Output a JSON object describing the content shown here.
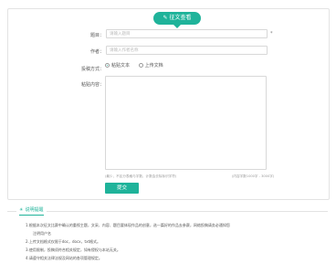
{
  "header": {
    "tab_label": "征文查看",
    "tab_icon": "edit-icon"
  },
  "form": {
    "title_label": "题目：",
    "title_placeholder": "请输入题目",
    "title_required": "*",
    "author_label": "作者：",
    "author_placeholder": "请输入作者名称",
    "method_label": "投稿方式：",
    "method_options": [
      "粘贴文本",
      "上传文档"
    ],
    "method_selected": "粘贴文本",
    "content_label": "粘贴内容：",
    "content_hint": "(最少，不区分表格与字数，计数会去除标识字符)",
    "content_limit": "(内容字数1000字 - 3000字)",
    "submit_label": "提交"
  },
  "guide": {
    "icon": "bulb-icon",
    "title": "说明提醒",
    "tips": [
      "1.根据本次征文比赛中确认的重视主题，文采、内容、题目要体现作品的创意，选一篇好的作品去参赛，网络投稿请务必通知您",
      "注明用户名",
      "2.上传文档格式仅限于doc，docx，txt格式。",
      "3.使用限制，投稿须符合相关规定，如有侵权与本站无关。",
      "4.请遵守相关法律法规及网站的各项管理规定。"
    ]
  },
  "colors": {
    "accent": "#1fb39a",
    "border": "#d8d8d8"
  }
}
